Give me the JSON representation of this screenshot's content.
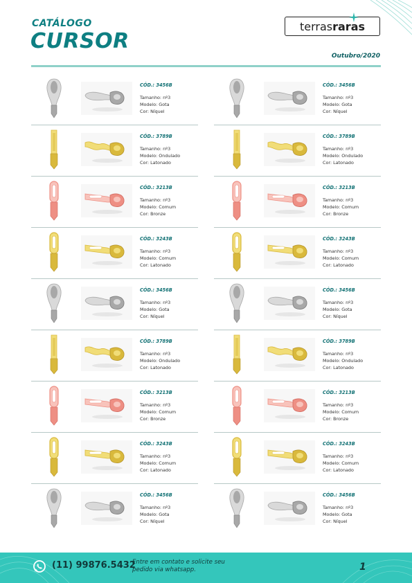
{
  "header": {
    "catalog_label": "CATÁLOGO",
    "title": "CURSOR",
    "date": "Outubro/2020",
    "brand": {
      "part1": "terras",
      "part2": "raras"
    }
  },
  "colors": {
    "accent": "#0e7f82",
    "footer": "#34c6bb",
    "silver": "#c4c4c4",
    "gold": "#e0c44a",
    "bronze": "#f2a8a0"
  },
  "products": [
    {
      "code": "CÓD.: 3456B",
      "tamanho": "Tamanho: nº3",
      "modelo": "Modelo: Gota",
      "cor": "Cor: Níquel"
    },
    {
      "code": "CÓD.: 3456B",
      "tamanho": "Tamanho: nº3",
      "modelo": "Modelo: Gota",
      "cor": "Cor: Níquel"
    },
    {
      "code": "CÓD.: 3789B",
      "tamanho": "Tamanho: nº3",
      "modelo": "Modelo: Ondulado",
      "cor": "Cor: Latonado"
    },
    {
      "code": "CÓD.: 3789B",
      "tamanho": "Tamanho: nº3",
      "modelo": "Modelo: Ondulado",
      "cor": "Cor: Latonado"
    },
    {
      "code": "CÓD.: 3213B",
      "tamanho": "Tamanho: nº3",
      "modelo": "Modelo: Comum",
      "cor": "Cor: Bronze"
    },
    {
      "code": "CÓD.: 3213B",
      "tamanho": "Tamanho: nº3",
      "modelo": "Modelo: Comum",
      "cor": "Cor: Bronze"
    },
    {
      "code": "CÓD.: 3243B",
      "tamanho": "Tamanho: nº3",
      "modelo": "Modelo: Comum",
      "cor": "Cor: Latonado"
    },
    {
      "code": "CÓD.: 3243B",
      "tamanho": "Tamanho: nº3",
      "modelo": "Modelo: Comum",
      "cor": "Cor: Latonado"
    },
    {
      "code": "CÓD.: 3456B",
      "tamanho": "Tamanho: nº3",
      "modelo": "Modelo: Gota",
      "cor": "Cor: Níquel"
    },
    {
      "code": "CÓD.: 3456B",
      "tamanho": "Tamanho: nº3",
      "modelo": "Modelo: Gota",
      "cor": "Cor: Níquel"
    },
    {
      "code": "CÓD.: 3789B",
      "tamanho": "Tamanho: nº3",
      "modelo": "Modelo: Ondulado",
      "cor": "Cor: Latonado"
    },
    {
      "code": "CÓD.: 3789B",
      "tamanho": "Tamanho: nº3",
      "modelo": "Modelo: Ondulado",
      "cor": "Cor: Latonado"
    },
    {
      "code": "CÓD.: 3213B",
      "tamanho": "Tamanho: nº3",
      "modelo": "Modelo: Comum",
      "cor": "Cor: Bronze"
    },
    {
      "code": "CÓD.: 3213B",
      "tamanho": "Tamanho: nº3",
      "modelo": "Modelo: Comum",
      "cor": "Cor: Bronze"
    },
    {
      "code": "CÓD.: 3243B",
      "tamanho": "Tamanho: nº3",
      "modelo": "Modelo: Comum",
      "cor": "Cor: Latonado"
    },
    {
      "code": "CÓD.: 3243B",
      "tamanho": "Tamanho: nº3",
      "modelo": "Modelo: Comum",
      "cor": "Cor: Latonado"
    },
    {
      "code": "CÓD.: 3456B",
      "tamanho": "Tamanho: nº3",
      "modelo": "Modelo: Gota",
      "cor": "Cor: Níquel"
    },
    {
      "code": "CÓD.: 3456B",
      "tamanho": "Tamanho: nº3",
      "modelo": "Modelo: Gota",
      "cor": "Cor: Níquel"
    }
  ],
  "footer": {
    "phone": "(11) 99876.5432",
    "cta_line1": "Entre em contato e solicite seu",
    "cta_line2": "pedido via whatsapp.",
    "page_number": "1",
    "icon": "whatsapp-icon"
  }
}
